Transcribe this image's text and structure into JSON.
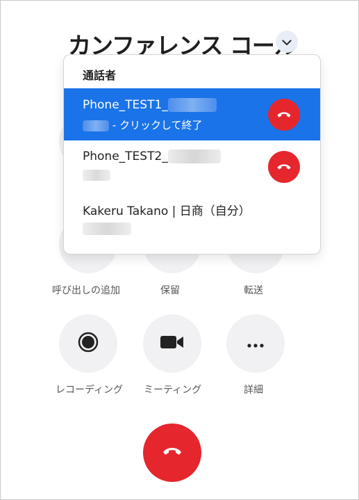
{
  "window": {
    "title": "カンファレンス コール"
  },
  "actions": [
    {
      "label": "呼び出しの追加",
      "icon": "add-call-icon"
    },
    {
      "label": "保留",
      "icon": "hold-icon"
    },
    {
      "label": "転送",
      "icon": "transfer-icon"
    },
    {
      "label": "レコーディング",
      "icon": "record-icon"
    },
    {
      "label": "ミーティング",
      "icon": "video-camera-icon"
    },
    {
      "label": "詳細",
      "icon": "more-icon"
    }
  ],
  "participants": {
    "header": "通話者",
    "items": [
      {
        "name": "Phone_TEST1_",
        "sub": "- クリックして終了",
        "selected": true
      },
      {
        "name": "Phone_TEST2_",
        "sub": "",
        "selected": false
      },
      {
        "name": "Kakeru Takano | 日商（自分）",
        "sub": "",
        "selected": false
      }
    ]
  },
  "colors": {
    "accent": "#1a73e8",
    "hangup": "#e5262d",
    "button_bg": "#f1f1f4"
  }
}
